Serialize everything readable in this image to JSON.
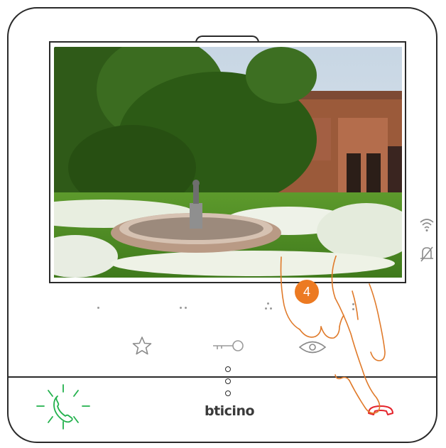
{
  "brand": {
    "name": "bticino"
  },
  "step_badge": {
    "number": "4"
  },
  "camera_view": {
    "content": "entrance-camera-image"
  },
  "status_icons": [
    "wifi-icon",
    "bell-muted-icon"
  ],
  "function_buttons": [
    {
      "id": "favorites",
      "icon": "star-icon"
    },
    {
      "id": "door-lock",
      "icon": "key-icon"
    },
    {
      "id": "cycle-camera",
      "icon": "eye-icon"
    }
  ],
  "call_controls": {
    "answer": {
      "icon": "handset-ringing-icon",
      "state": "ringing",
      "color": "#22b14c"
    },
    "end": {
      "icon": "hang-up-icon",
      "color": "#e4232b"
    }
  },
  "colors": {
    "badge": "#ec7a22",
    "hand": "#e07a2a",
    "frame": "#2a2a2a"
  }
}
